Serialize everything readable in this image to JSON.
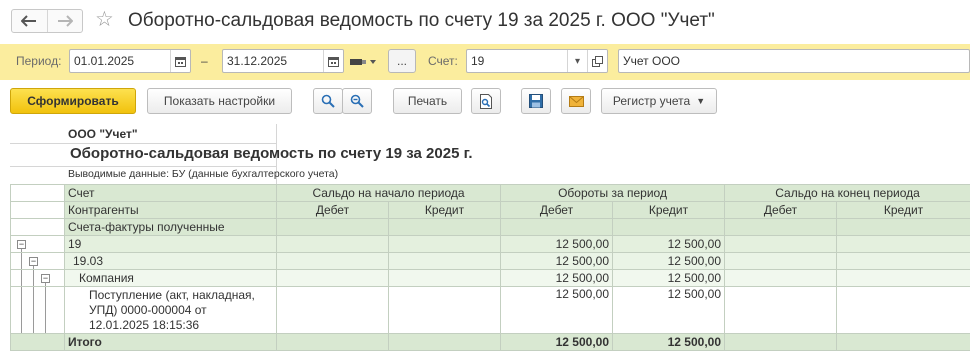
{
  "window": {
    "back_icon": "arrow-left-icon",
    "forward_icon": "arrow-right-icon",
    "favorite_icon": "star-icon",
    "title": "Оборотно-сальдовая ведомость по счету 19 за 2025 г. ООО \"Учет\""
  },
  "params": {
    "period_label": "Период:",
    "date_from": "01.01.2025",
    "dash": "–",
    "date_to": "31.12.2025",
    "ellipsis": "...",
    "account_label": "Счет:",
    "account": "19",
    "organization": "Учет ООО"
  },
  "toolbar": {
    "generate": "Сформировать",
    "show_settings": "Показать настройки",
    "print": "Печать",
    "registry": "Регистр учета"
  },
  "report": {
    "org": "ООО \"Учет\"",
    "title": "Оборотно-сальдовая ведомость по счету 19 за 2025 г.",
    "subtitle": "Выводимые данные: БУ (данные бухгалтерского учета)",
    "headers": {
      "account": "Счет",
      "counterparties": "Контрагенты",
      "invoices": "Счета-фактуры полученные",
      "opening": "Сальдо на начало периода",
      "turnover": "Обороты за период",
      "closing": "Сальдо на конец периода",
      "debit": "Дебет",
      "credit": "Кредит"
    },
    "rows": [
      {
        "name": "19",
        "open_d": "",
        "open_c": "",
        "turn_d": "12 500,00",
        "turn_c": "12 500,00",
        "close_d": "",
        "close_c": ""
      },
      {
        "name": "19.03",
        "open_d": "",
        "open_c": "",
        "turn_d": "12 500,00",
        "turn_c": "12 500,00",
        "close_d": "",
        "close_c": ""
      },
      {
        "name": "Компания",
        "open_d": "",
        "open_c": "",
        "turn_d": "12 500,00",
        "turn_c": "12 500,00",
        "close_d": "",
        "close_c": ""
      },
      {
        "name_lines": [
          "Поступление (акт, накладная,",
          "УПД) 0000-000004 от",
          "12.01.2025 18:15:36"
        ],
        "open_d": "",
        "open_c": "",
        "turn_d": "12 500,00",
        "turn_c": "12 500,00",
        "close_d": "",
        "close_c": ""
      }
    ],
    "total": {
      "label": "Итого",
      "turn_d": "12 500,00",
      "turn_c": "12 500,00"
    }
  },
  "colors": {
    "params_bg": "#fbed9e",
    "primary_button": "#f1c20d",
    "header_bg": "#d9e8d2"
  }
}
